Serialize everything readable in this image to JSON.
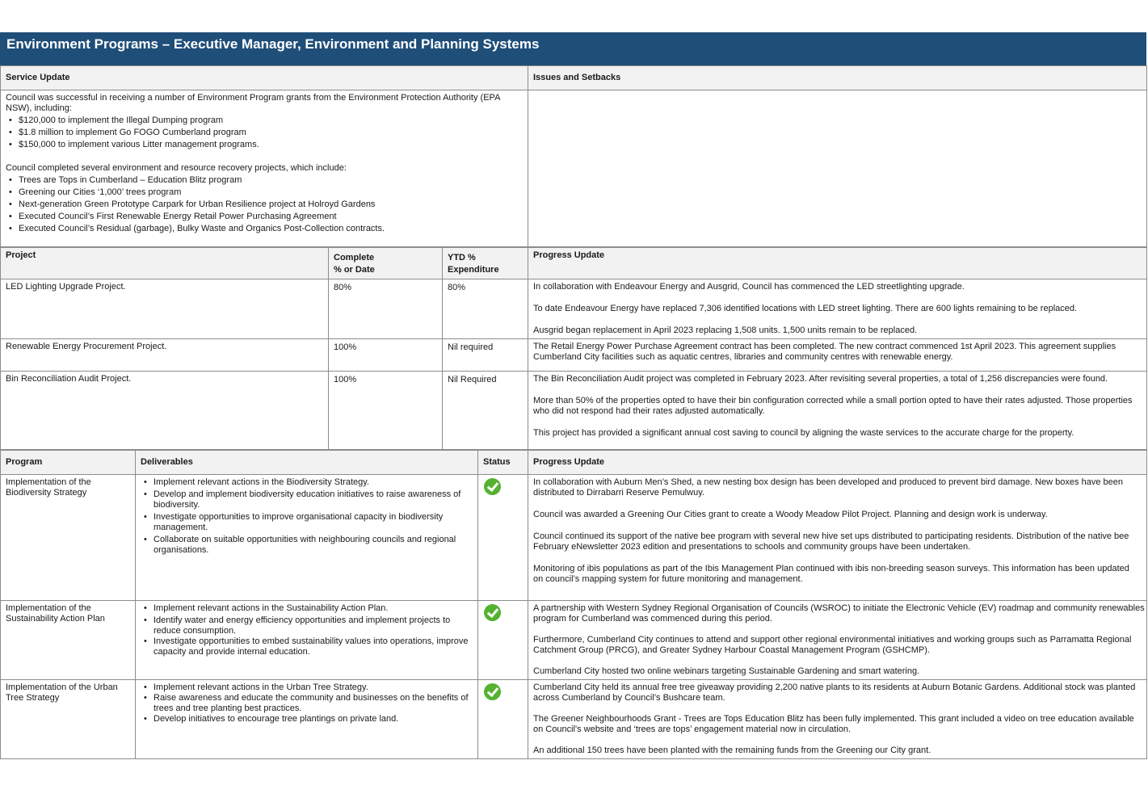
{
  "title": "Environment Programs – Executive Manager, Environment and Planning Systems",
  "service": {
    "header_left": "Service Update",
    "header_right": "Issues and Setbacks",
    "intro1": "Council was successful in receiving a number of Environment Program grants from the Environment Protection Authority (EPA NSW), including:",
    "list1": [
      "$120,000 to implement the Illegal Dumping program",
      "$1.8 million to implement Go FOGO Cumberland program",
      "$150,000 to implement various Litter management programs."
    ],
    "intro2": "Council completed several environment and resource recovery projects, which include:",
    "list2": [
      "Trees are Tops in Cumberland – Education Blitz program",
      "Greening our Cities ‘1,000’ trees program",
      "Next-generation Green Prototype Carpark for Urban Resilience project at Holroyd Gardens",
      "Executed Council’s First Renewable Energy Retail Power Purchasing Agreement",
      "Executed Council’s Residual (garbage), Bulky Waste and Organics Post-Collection contracts."
    ]
  },
  "projects": {
    "headers": {
      "project": "Project",
      "complete_line1": "Complete",
      "complete_line2": "% or Date",
      "ytd_line1": "YTD %",
      "ytd_line2": "Expenditure",
      "progress": "Progress Update"
    },
    "rows": [
      {
        "name": "LED Lighting Upgrade Project.",
        "complete": "80%",
        "ytd": "80%",
        "progress": [
          "In collaboration with Endeavour Energy and Ausgrid, Council has commenced the LED streetlighting upgrade.",
          "To date Endeavour Energy have replaced 7,306 identified locations with LED street lighting. There are 600 lights remaining to be replaced.",
          "Ausgrid began replacement in April 2023 replacing 1,508 units. 1,500 units remain to be replaced."
        ]
      },
      {
        "name": "Renewable Energy Procurement Project.",
        "complete": "100%",
        "ytd": "Nil required",
        "progress": [
          "The Retail Energy Power Purchase Agreement contract has been completed. The new contract commenced 1st April 2023. This agreement supplies Cumberland City facilities such as aquatic centres, libraries and community centres with renewable energy."
        ]
      },
      {
        "name": "Bin Reconciliation Audit Project.",
        "complete": "100%",
        "ytd": "Nil Required",
        "progress": [
          "The Bin Reconciliation Audit project was completed in February 2023. After revisiting several properties, a total of 1,256 discrepancies were found.",
          "More than 50% of the properties opted to have their bin configuration corrected while a small portion opted to have their rates adjusted. Those properties who did not respond had their rates adjusted automatically.",
          "This project has provided a significant annual cost saving to council by aligning the waste services to the accurate charge for the property."
        ]
      }
    ]
  },
  "programs": {
    "headers": {
      "program": "Program",
      "deliverables": "Deliverables",
      "status": "Status",
      "progress": "Progress Update"
    },
    "status_color": "#55b230",
    "rows": [
      {
        "name": "Implementation of the Biodiversity Strategy",
        "status_icon": "check-circle-icon",
        "deliverables": [
          "Implement relevant actions in the Biodiversity Strategy.",
          "Develop and implement biodiversity education initiatives to raise awareness of biodiversity.",
          "Investigate opportunities to improve organisational capacity in biodiversity management.",
          "Collaborate on suitable opportunities with neighbouring councils and regional organisations."
        ],
        "progress": [
          "In collaboration with Auburn Men’s Shed, a new nesting box design has been developed and produced to prevent bird damage. New boxes have been distributed to Dirrabarri Reserve Pemulwuy.",
          "Council was awarded a Greening Our Cities grant to create a Woody Meadow Pilot Project. Planning and design work is underway.",
          "Council continued its support of the native bee program with several new hive set ups distributed to participating residents. Distribution of the native bee February eNewsletter 2023 edition and presentations to schools and community groups have been undertaken.",
          "Monitoring of ibis populations as part of the Ibis Management Plan continued with ibis non-breeding season surveys. This information has been updated on council’s mapping system for future monitoring and management."
        ]
      },
      {
        "name": "Implementation of the Sustainability Action Plan",
        "status_icon": "check-circle-icon",
        "deliverables": [
          "Implement relevant actions in the Sustainability Action Plan.",
          "Identify water and energy efficiency opportunities and implement projects to reduce consumption.",
          "Investigate opportunities to embed sustainability values into operations, improve  capacity and provide internal education."
        ],
        "progress": [
          "A partnership with Western Sydney Regional Organisation of Councils (WSROC) to initiate the Electronic Vehicle (EV) roadmap and community renewables program for Cumberland was commenced during this period.",
          "Furthermore, Cumberland City continues to attend and support other regional environmental initiatives and working groups such as Parramatta Regional Catchment Group (PRCG), and Greater Sydney Harbour Coastal Management Program (GSHCMP).",
          "Cumberland City hosted two online webinars targeting Sustainable Gardening and smart watering."
        ]
      },
      {
        "name": "Implementation of the Urban Tree Strategy",
        "status_icon": "check-circle-icon",
        "deliverables": [
          "Implement relevant actions in the Urban Tree Strategy.",
          "Raise awareness and educate the community and businesses on the benefits of trees and tree planting best practices.",
          "Develop initiatives to encourage tree plantings on private land."
        ],
        "progress": [
          "Cumberland City held its annual free tree giveaway providing 2,200 native plants to its residents at Auburn Botanic Gardens. Additional stock was planted across Cumberland by Council’s Bushcare team.",
          "The Greener Neighbourhoods Grant - Trees are Tops Education Blitz has been fully implemented. This grant included a video on tree education available on Council's website and ‘trees are tops’ engagement material now in circulation.",
          "An additional 150 trees have been planted with the remaining funds from the Greening our City grant."
        ]
      }
    ]
  }
}
